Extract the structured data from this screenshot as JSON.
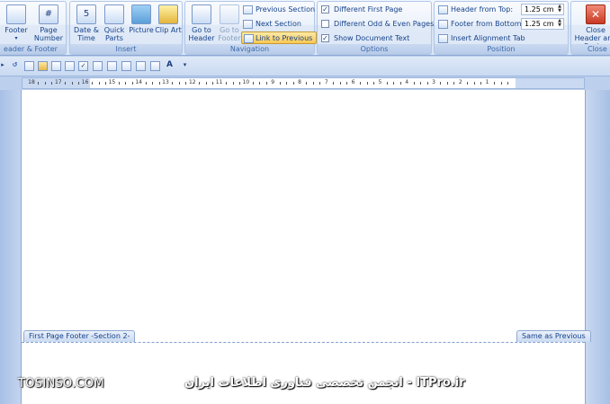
{
  "ribbon": {
    "header_footer_group": {
      "label": "eader & Footer",
      "footer": "Footer",
      "page_number": "Page Number"
    },
    "insert_group": {
      "label": "Insert",
      "date_time": "Date & Time",
      "quick_parts": "Quick Parts",
      "picture": "Picture",
      "clip_art": "Clip Art"
    },
    "navigation_group": {
      "label": "Navigation",
      "go_to_header": "Go to Header",
      "go_to_footer": "Go to Footer",
      "previous_section": "Previous Section",
      "next_section": "Next Section",
      "link_to_previous": "Link to Previous"
    },
    "options_group": {
      "label": "Options",
      "different_first_page": "Different First Page",
      "different_odd_even": "Different Odd & Even Pages",
      "show_document_text": "Show Document Text",
      "different_first_page_checked": true,
      "different_odd_even_checked": false,
      "show_document_text_checked": true
    },
    "position_group": {
      "label": "Position",
      "header_from_top": "Header from Top:",
      "header_from_top_value": "1.25 cm",
      "footer_from_bottom": "Footer from Bottom:",
      "footer_from_bottom_value": "1.25 cm",
      "insert_alignment_tab": "Insert Alignment Tab"
    },
    "close_group": {
      "label": "Close",
      "close_header_footer": "Close Header and Footer"
    }
  },
  "toolbar": {
    "icons": [
      "undo-icon",
      "new-icon",
      "open-icon",
      "save-icon",
      "print-preview-icon",
      "spelling-icon",
      "format-painter-icon",
      "table-icon",
      "drawing-icon",
      "document-map-icon",
      "show-hide-icon",
      "text-direction-icon",
      "more-icon"
    ]
  },
  "ruler": {
    "numbers": [
      "18",
      "17",
      "16",
      "15",
      "14",
      "13",
      "12",
      "11",
      "10",
      "9",
      "8",
      "7",
      "6",
      "5",
      "4",
      "3",
      "2",
      "1"
    ]
  },
  "document": {
    "footer_tag": "First Page Footer -Section 2-",
    "same_as_previous": "Same as Previous"
  },
  "watermark": {
    "left": "TOSINSO.COM",
    "right": "ITPro.ir - انجمن تخصصی فناوری اطلاعات ایران"
  },
  "colors": {
    "ribbon_text": "#15428b",
    "active_button": "#f9c851",
    "close_button": "#c83a23"
  }
}
